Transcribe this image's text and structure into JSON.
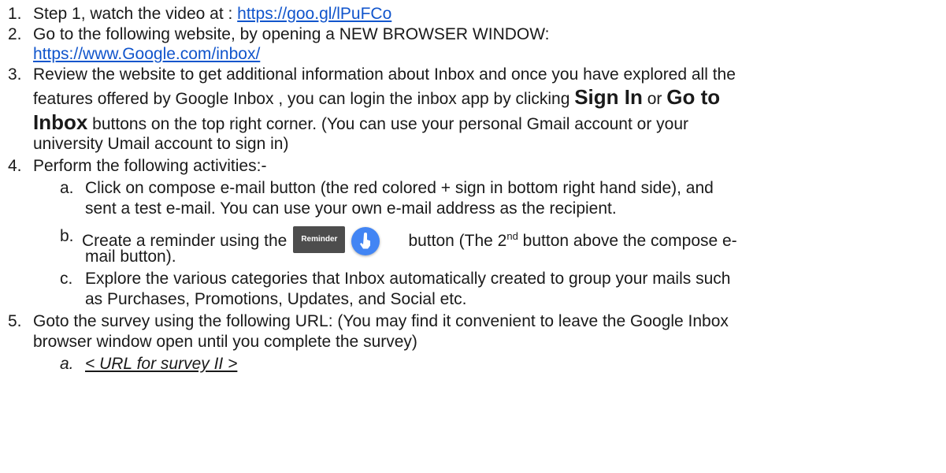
{
  "items": [
    {
      "num": "1.",
      "text_before": "Step 1, watch the video at :  ",
      "link": "https://goo.gl/lPuFCo"
    },
    {
      "num": "2.",
      "text": "Go to the following website, by opening a NEW BROWSER WINDOW:",
      "link": "https://www.Google.com/inbox/"
    },
    {
      "num": "3.",
      "line1": "Review the website to get additional information about Inbox and once you have explored all the",
      "line2_before": "features offered by Google Inbox , you can login the inbox app by clicking ",
      "sign_in": "Sign In",
      "or": " or ",
      "go_to": "Go to",
      "inbox": "Inbox",
      "line3_after": " buttons on the top right corner. (You can use your personal Gmail account or your",
      "line4": "university Umail account to sign in)"
    },
    {
      "num": "4.",
      "text": "Perform the following activities:-"
    },
    {
      "num": "5.",
      "line1": "Goto the survey using the following URL:  (You may find it convenient to leave the Google Inbox",
      "line2": "browser window open until you complete the survey)"
    }
  ],
  "subitems": [
    {
      "letter": "a.",
      "line1": "Click on compose e-mail button (the red colored + sign in bottom right hand side), and",
      "line2": "sent a test e-mail. You can use your own e-mail address as the recipient."
    },
    {
      "letter": "b.",
      "before": " Create a reminder using the",
      "reminder_label": "Reminder",
      "after_1": "button (The 2",
      "sup": "nd",
      "after_2": " button above the compose e-",
      "line2": "mail button)."
    },
    {
      "letter": "c.",
      "line1": "Explore the various categories that Inbox automatically created to group your mails such",
      "line2": "as Purchases, Promotions, Updates, and Social etc."
    }
  ],
  "survey": {
    "letter": "a.",
    "text": "< URL for survey II >"
  },
  "colors": {
    "link": "#1155cc",
    "text": "#1a1a1a",
    "fab": "#4285f4",
    "reminder_bg": "#4d4d4d"
  },
  "icons": {
    "fab": "hand-pointer-icon"
  }
}
